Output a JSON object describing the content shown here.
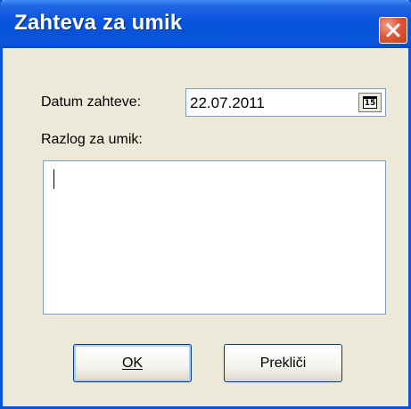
{
  "window": {
    "title": "Zahteva za umik"
  },
  "form": {
    "date_label": "Datum zahteve:",
    "date_value": "22.07.2011",
    "calendar_icon_text": "15",
    "reason_label": "Razlog za umik:",
    "reason_value": ""
  },
  "buttons": {
    "ok_label": "OK",
    "cancel_label": "Prekliči"
  },
  "colors": {
    "titlebar": "#0652d8",
    "window_bg": "#ece9d8",
    "close_button": "#e0593a"
  },
  "icons": {
    "close": "close-icon",
    "calendar": "calendar-icon"
  }
}
